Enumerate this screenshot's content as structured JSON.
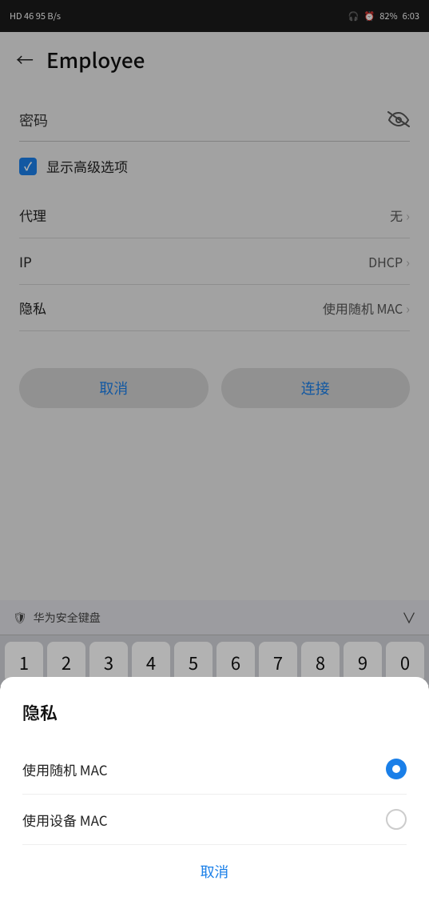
{
  "statusBar": {
    "leftText": "HD 46 95 B/s",
    "rightText": "82% 6:03",
    "battery": "82%",
    "time": "6:03"
  },
  "header": {
    "backLabel": "←",
    "title": "Employee"
  },
  "form": {
    "passwordLabel": "密码",
    "showAdvancedLabel": "显示高级选项",
    "proxyLabel": "代理",
    "proxyValue": "无",
    "ipLabel": "IP",
    "ipValue": "DHCP",
    "privacyLabel": "隐私",
    "privacyValue": "使用随机 MAC"
  },
  "buttons": {
    "cancelLabel": "取消",
    "connectLabel": "连接"
  },
  "keyboard": {
    "toolbarLabel": "华为安全键盘",
    "keys": [
      "1",
      "2",
      "3",
      "4",
      "5",
      "6",
      "7",
      "8",
      "9",
      "0"
    ]
  },
  "dialog": {
    "title": "隐私",
    "option1": "使用随机 MAC",
    "option2": "使用设备 MAC",
    "cancelLabel": "取消"
  },
  "icons": {
    "back": "←",
    "eyeHidden": "👁",
    "chevron": "›",
    "checkmark": "✓",
    "shield": "🛡",
    "chevronDown": "⌄"
  }
}
